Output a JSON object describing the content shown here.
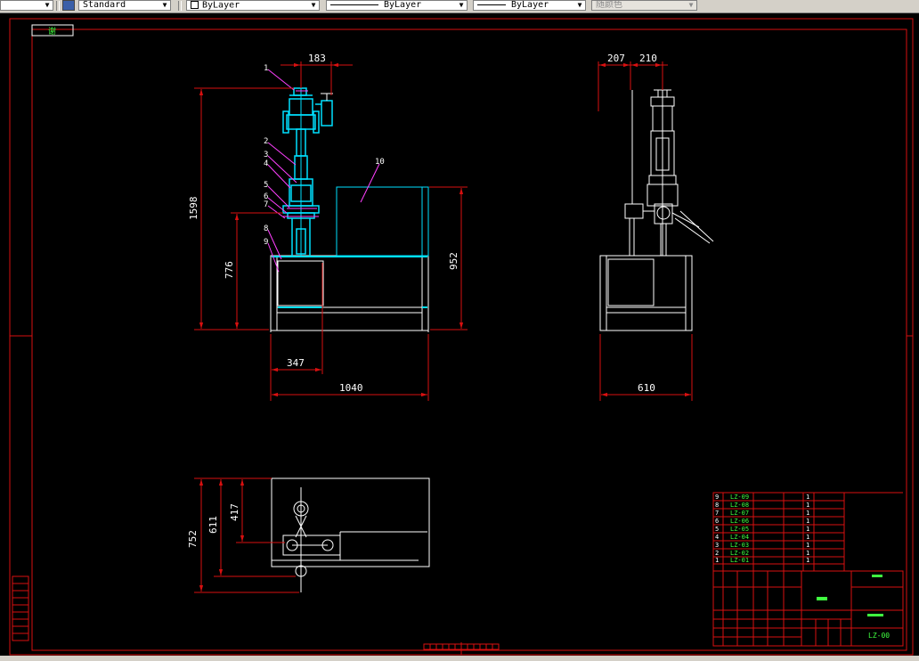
{
  "toolbar": {
    "textstyle": "Standard",
    "layer": "ByLayer",
    "linetype": "ByLayer",
    "lineweight": "ByLayer",
    "plotstyle": "随颜色"
  },
  "drawing": {
    "corner_tag": "谢",
    "front_view": {
      "dims": {
        "d183": "183",
        "d1598": "1598",
        "d776": "776",
        "d952": "952",
        "d347": "347",
        "d1040": "1040"
      },
      "balloons": [
        "1",
        "2",
        "3",
        "4",
        "5",
        "6",
        "7",
        "8",
        "9",
        "10"
      ]
    },
    "side_view": {
      "dims": {
        "d207": "207",
        "d210": "210",
        "d610": "610"
      }
    },
    "top_view": {
      "dims": {
        "d752": "752",
        "d611": "611",
        "d417": "417"
      }
    },
    "bom": {
      "rows": [
        {
          "no": "9",
          "code": "LZ-09",
          "qty": "1"
        },
        {
          "no": "8",
          "code": "LZ-08",
          "qty": "1"
        },
        {
          "no": "7",
          "code": "LZ-07",
          "qty": "1"
        },
        {
          "no": "6",
          "code": "LZ-06",
          "qty": "1"
        },
        {
          "no": "5",
          "code": "LZ-05",
          "qty": "1"
        },
        {
          "no": "4",
          "code": "LZ-04",
          "qty": "1"
        },
        {
          "no": "3",
          "code": "LZ-03",
          "qty": "1"
        },
        {
          "no": "2",
          "code": "LZ-02",
          "qty": "1"
        },
        {
          "no": "1",
          "code": "LZ-01",
          "qty": "1"
        }
      ]
    },
    "title_block": {
      "code": "LZ-00"
    }
  },
  "colors": {
    "frame": "#d81010",
    "part": "#00e0ff",
    "line": "#ffffff",
    "balloon": "#ff40ff",
    "text": "#ffffff",
    "bom_text": "#40ff40",
    "toolbar": "#d4d0c8"
  }
}
